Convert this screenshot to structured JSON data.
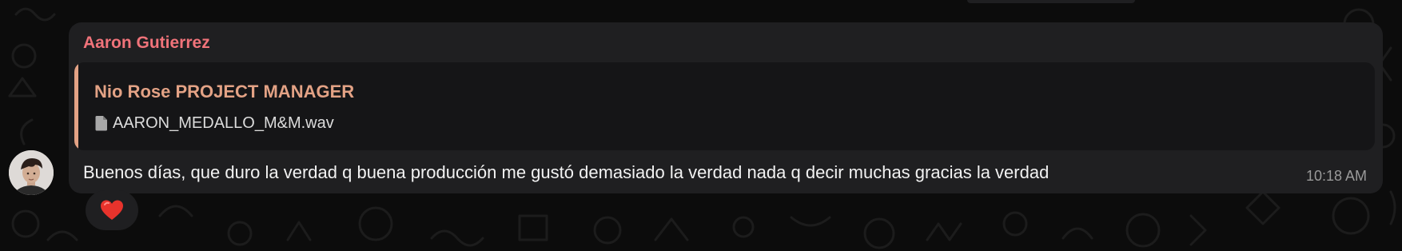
{
  "colors": {
    "background": "#0c0c0c",
    "bubble": "#1f1f21",
    "quote_background": "#151517",
    "sender_name": "#f0737a",
    "quote_accent": "#e3a285",
    "text": "#f2f2f2",
    "timestamp": "#9a9a9a",
    "reaction": "#e8332c"
  },
  "message": {
    "sender": "Aaron Gutierrez",
    "avatar_icon": "user-avatar-photo",
    "quoted": {
      "author": "Nio Rose PROJECT MANAGER",
      "file_icon": "file-icon",
      "file_name": "AARON_MEDALLO_M&M.wav"
    },
    "text": "Buenos días, que duro la verdad q buena producción me gustó demasiado la verdad nada q decir muchas gracias la verdad",
    "time": "10:18 AM",
    "reaction": {
      "emoji": "❤️",
      "icon": "red-heart-icon"
    }
  }
}
